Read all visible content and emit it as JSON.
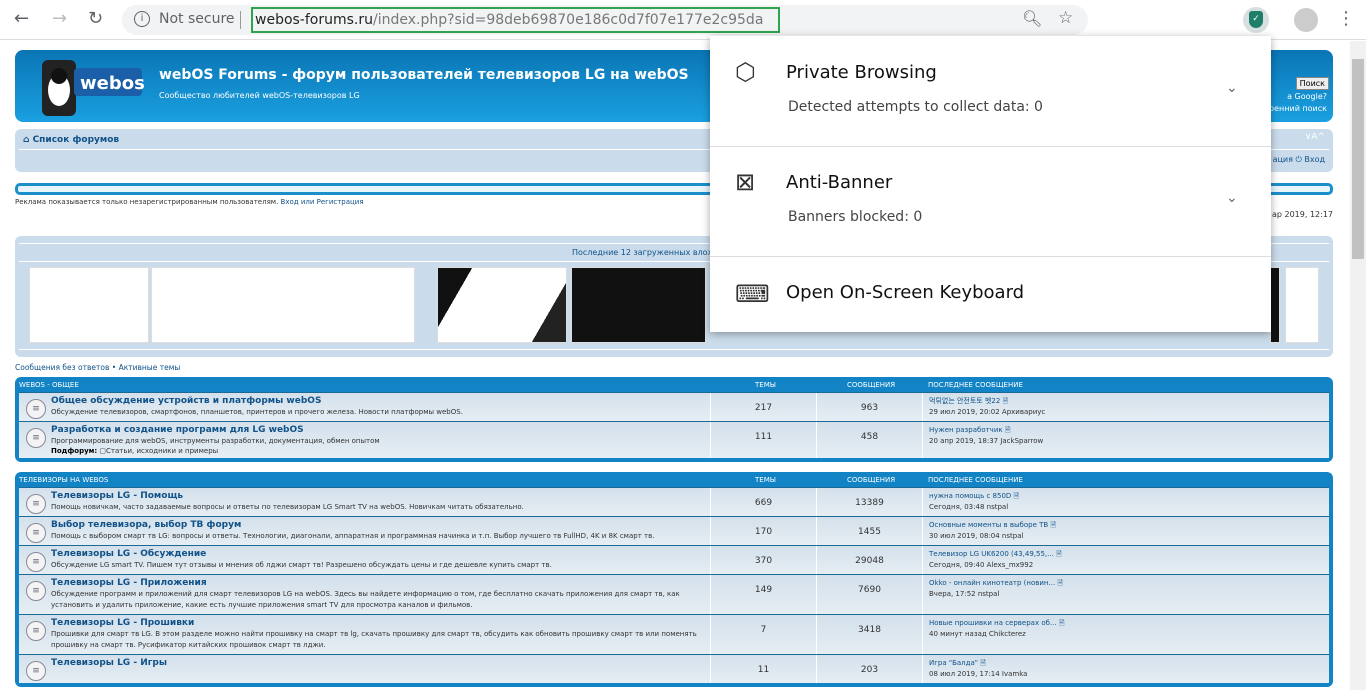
{
  "browser": {
    "not_secure": "Not secure",
    "url_host": "webos-forums.ru",
    "url_rest": "/index.php?sid=98deb69870e186c0d7f07e177e2c95da"
  },
  "popup": {
    "items": [
      {
        "title": "Private Browsing",
        "subtitle": "Detected attempts to collect data: 0",
        "icon": "private-browsing-icon"
      },
      {
        "title": "Anti-Banner",
        "subtitle": "Banners blocked: 0",
        "icon": "anti-banner-icon"
      },
      {
        "title": "Open On-Screen Keyboard",
        "icon": "keyboard-icon"
      }
    ]
  },
  "header": {
    "logo_text": "webOS",
    "title": "webOS Forums - форум пользователей телевизоров LG на webOS",
    "subtitle": "Сообщество любителей webOS-телевизоров LG",
    "search_button": "Поиск",
    "search_option": "а Google?",
    "advanced_search": "ренний поиск"
  },
  "navbar": {
    "crumb": "Список форумов",
    "font_size": "∨A^",
    "login": "ация  ⏻ Вход"
  },
  "ad_text": "Реклама показывается только незарегистрированным пользователям.",
  "ad_links": "Вход или Регистрация",
  "date": "ар 2019, 12:17",
  "attachments_caption": "Последние 12 загруженных влож",
  "quick_links": "Сообщения без ответов • Активные темы",
  "columns": {
    "topics": "ТЕМЫ",
    "posts": "СООБЩЕНИЯ",
    "last": "ПОСЛЕДНЕЕ СООБЩЕНИЕ"
  },
  "categories": [
    {
      "name": "WEBOS - ОБЩЕЕ",
      "forums": [
        {
          "title": "Общее обсуждение устройств и платформы webOS",
          "desc": "Обсуждение телевизоров, смартфонов, планшетов, принтеров и прочего железа. Новости платформы webOS.",
          "topics": "217",
          "posts": "963",
          "last_title": "먹튀없는 안전토토 벳22",
          "last_meta": "29 июл 2019, 20:02 Архивариус"
        },
        {
          "title": "Разработка и создание программ для LG webOS",
          "desc": "Программирование для webOS, инструменты разработки, документация, обмен опытом",
          "sub_label": "Подфорум:",
          "sub": "Статьи, исходники и примеры",
          "topics": "111",
          "posts": "458",
          "last_title": "Нужен разработчик",
          "last_meta": "20 апр 2019, 18:37 JackSparrow"
        }
      ]
    },
    {
      "name": "ТЕЛЕВИЗОРЫ НА WEBOS",
      "forums": [
        {
          "title": "Телевизоры LG - Помощь",
          "desc": "Помощь новичкам, часто задаваемые вопросы и ответы по телевизорам LG Smart TV на webOS. Новичкам читать обязательно.",
          "topics": "669",
          "posts": "13389",
          "last_title": "нужна помощь с 850D",
          "last_meta": "Сегодня, 03:48 nstpal"
        },
        {
          "title": "Выбор телевизора, выбор ТВ форум",
          "desc": "Помощь с выбором смарт тв LG: вопросы и ответы. Технологии, диагонали, аппаратная и программная начинка и т.п. Выбор лучшего тв FullHD, 4K и 8K смарт тв.",
          "topics": "170",
          "posts": "1455",
          "last_title": "Основные моменты в выборе ТВ",
          "last_meta": "30 июл 2019, 08:04 nstpal"
        },
        {
          "title": "Телевизоры LG - Обсуждение",
          "desc": "Обсуждение LG smart TV. Пишем тут отзывы и мнения об лджи смарт тв! Разрешено обсуждать цены и где дешевле купить смарт тв.",
          "topics": "370",
          "posts": "29048",
          "last_title": "Телевизор LG UK6200 (43,49,55,...",
          "last_meta": "Сегодня, 09:40 Alexs_mx992"
        },
        {
          "title": "Телевизоры LG - Приложения",
          "desc": "Обсуждение программ и приложений для смарт телевизоров LG на webOS. Здесь вы найдете информацию о том, где бесплатно скачать приложения для смарт тв, как установить и удалить приложение, какие есть лучшие приложения smart TV для просмотра каналов и фильмов.",
          "topics": "149",
          "posts": "7690",
          "last_title": "Okko - онлайн кинотеатр (новин...",
          "last_meta": "Вчера, 17:52 nstpal"
        },
        {
          "title": "Телевизоры LG - Прошивки",
          "desc": "Прошивки для смарт тв LG. В этом разделе можно найти прошивку на смарт тв lg, скачать прошивку для смарт тв, обсудить как обновить прошивку смарт тв или поменять прошивку на смарт тв. Русификатор китайских прошивок смарт тв лджи.",
          "topics": "7",
          "posts": "3418",
          "last_title": "Новые прошивки на серверах об...",
          "last_meta": "40 минут назад Chikcterez"
        },
        {
          "title": "Телевизоры LG - Игры",
          "desc": "",
          "topics": "11",
          "posts": "203",
          "last_title": "Игра \"Балда\"",
          "last_meta": "08 июл 2019, 17:14 Ivamka"
        }
      ]
    }
  ]
}
